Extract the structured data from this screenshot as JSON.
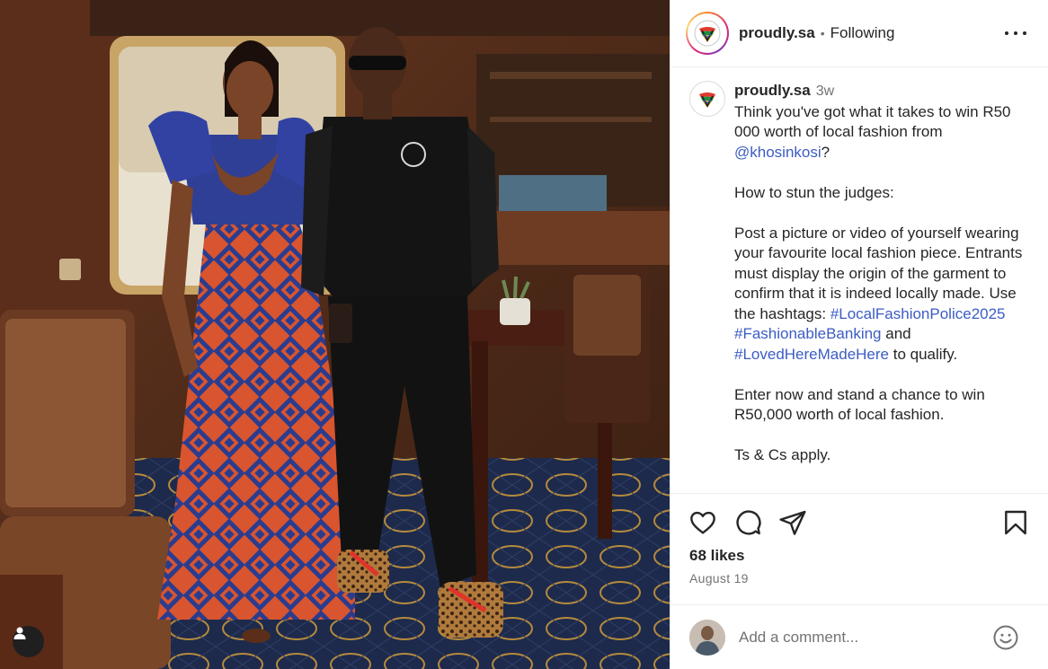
{
  "post": {
    "username": "proudly.sa",
    "follow_status": "Following",
    "separator": "•"
  },
  "caption": {
    "username": "proudly.sa",
    "time": "3w",
    "line1_a": "Think you've got what it takes to win R50 000 worth of local fashion from ",
    "mention": "@khosinkosi",
    "line1_b": "?",
    "line2": "How to stun the judges:",
    "line3": "Post a picture or video of yourself wearing your favourite local fashion piece. Entrants must display the origin of the garment to confirm that it is indeed locally made. Use the hashtags: ",
    "hashtag1": "#LocalFashionPolice2025",
    "hashtag2": "#FashionableBanking",
    "and_text": " and ",
    "hashtag3": "#LovedHereMadeHere",
    "qualify_text": " to qualify.",
    "line4": "Enter now and stand a chance to win R50,000 worth of local fashion.",
    "line5": "Ts & Cs apply."
  },
  "stats": {
    "likes": "68 likes",
    "date": "August 19"
  },
  "comment": {
    "placeholder": "Add a comment..."
  },
  "icons": {
    "like": "heart-icon",
    "comment": "comment-icon",
    "share": "send-icon",
    "save": "bookmark-icon",
    "more": "more-dots-icon",
    "emoji": "emoji-icon",
    "tagged_users": "user-tag-icon"
  },
  "colors": {
    "link": "#3b5cc4",
    "text": "#262626",
    "muted": "#737373"
  }
}
